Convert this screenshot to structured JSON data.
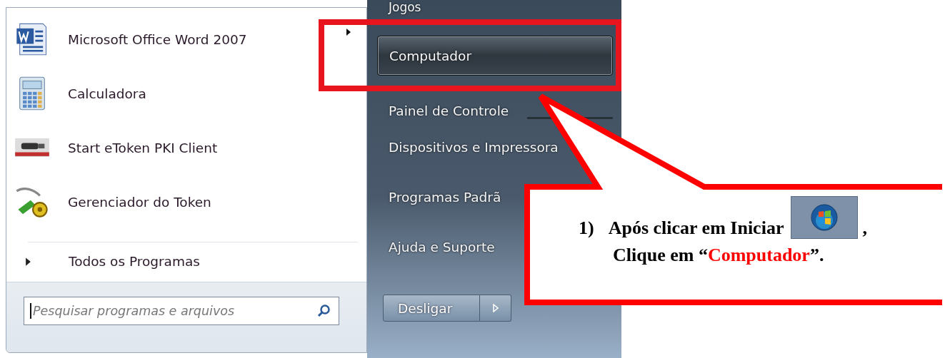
{
  "start_menu": {
    "programs": [
      {
        "name": "Microsoft Office Word 2007",
        "kind": "word",
        "submenu": true
      },
      {
        "name": "Calculadora",
        "kind": "calculator",
        "submenu": false
      },
      {
        "name": "Start eToken PKI Client",
        "kind": "token",
        "submenu": false
      },
      {
        "name": "Gerenciador do Token",
        "kind": "manager",
        "submenu": false
      }
    ],
    "all_programs": "Todos os Programas",
    "search": {
      "placeholder": "Pesquisar programas e arquivos"
    },
    "places": [
      {
        "label": "Jogos",
        "selected": false,
        "separator_after": false
      },
      {
        "label": "Computador",
        "selected": true,
        "separator_after": false
      },
      {
        "label": "Painel de Controle",
        "selected": false,
        "separator_after": true
      },
      {
        "label": "Dispositivos e Impressora",
        "selected": false,
        "separator_after": false
      },
      {
        "label": "Programas Padrã",
        "selected": false,
        "separator_after": false
      },
      {
        "label": "Ajuda e Suporte",
        "selected": false,
        "separator_after": false
      }
    ],
    "shutdown": {
      "label": "Desligar"
    }
  },
  "callout": {
    "number": "1)",
    "line_1": "Após clicar em Iniciar",
    "after_icon": ",",
    "line_2": {
      "before": "Clique em “",
      "highlight": "Computador",
      "after": "”."
    }
  }
}
